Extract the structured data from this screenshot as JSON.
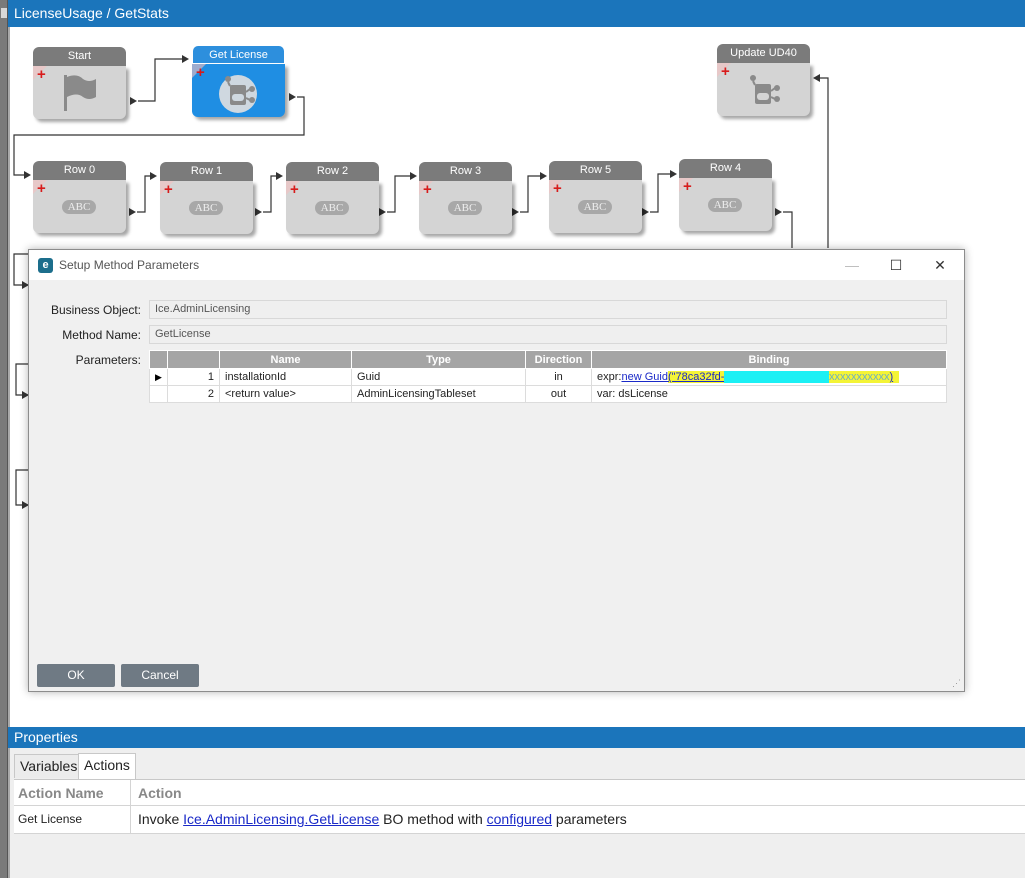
{
  "window_title": "LicenseUsage / GetStats",
  "nodes": {
    "start": {
      "label": "Start"
    },
    "get_license": {
      "label": "Get License"
    },
    "update_ud40": {
      "label": "Update UD40"
    },
    "row0": {
      "label": "Row 0",
      "badge": "ABC"
    },
    "row1": {
      "label": "Row 1",
      "badge": "ABC"
    },
    "row2": {
      "label": "Row 2",
      "badge": "ABC"
    },
    "row3": {
      "label": "Row 3",
      "badge": "ABC"
    },
    "row5": {
      "label": "Row 5",
      "badge": "ABC"
    },
    "row4": {
      "label": "Row 4",
      "badge": "ABC"
    }
  },
  "dialog": {
    "title": "Setup Method Parameters",
    "app_icon_letter": "e",
    "minimize_glyph": "—",
    "maximize_glyph": "☐",
    "close_glyph": "✕",
    "business_object_label": "Business Object:",
    "business_object_value": "Ice.AdminLicensing",
    "method_name_label": "Method Name:",
    "method_name_value": "GetLicense",
    "parameters_label": "Parameters:",
    "columns": {
      "name": "Name",
      "type": "Type",
      "direction": "Direction",
      "binding": "Binding"
    },
    "rows": [
      {
        "index": "1",
        "name": "installationId",
        "type": "Guid",
        "direction": "in",
        "binding_prefix": "expr:",
        "binding_link": "new Guid",
        "binding_value": "(\"78ca32fd-",
        "binding_tail": ")"
      },
      {
        "index": "2",
        "name": "<return value>",
        "type": "AdminLicensingTableset",
        "direction": "out",
        "binding_prefix": "var: dsLicense"
      }
    ],
    "ok_label": "OK",
    "cancel_label": "Cancel"
  },
  "properties": {
    "title": "Properties",
    "tabs": [
      "Variables",
      "Actions"
    ],
    "active_tab": "Actions",
    "columns": {
      "action_name": "Action Name",
      "action": "Action"
    },
    "rows": [
      {
        "action_name": "Get License",
        "prefix": "Invoke ",
        "link1": "Ice.AdminLicensing.GetLicense",
        "middle": " BO method with ",
        "link2": "configured",
        "suffix": " parameters"
      }
    ]
  },
  "colors": {
    "title_bar": "#1b75bb",
    "active_node": "#1f8ee3",
    "node_header": "#7b7b7b",
    "highlight": "#f4f436",
    "redaction": "#1cf0f4"
  }
}
